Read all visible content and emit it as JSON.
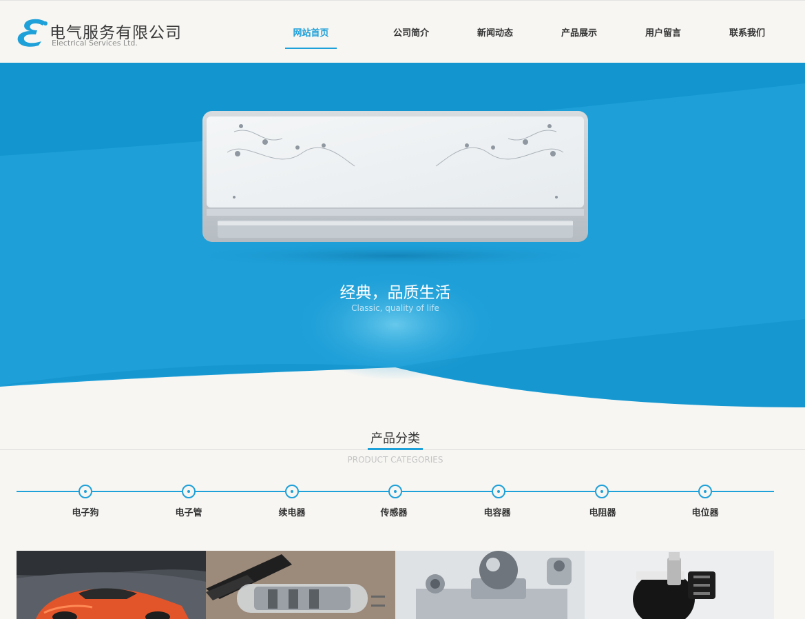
{
  "brand": {
    "name_cn": "电气服务有限公司",
    "name_en": "Electrical Services Ltd.",
    "logo_icon": "e-letter-logo",
    "accent_color": "#1ea0d8"
  },
  "nav": {
    "items": [
      {
        "label": "网站首页",
        "active": true
      },
      {
        "label": "公司简介",
        "active": false
      },
      {
        "label": "新闻动态",
        "active": false
      },
      {
        "label": "产品展示",
        "active": false
      },
      {
        "label": "用户留言",
        "active": false
      },
      {
        "label": "联系我们",
        "active": false
      }
    ]
  },
  "banner": {
    "title": "经典，品质生活",
    "subtitle": "Classic, quality of life",
    "image": "air-conditioner-image"
  },
  "categories": {
    "title": "产品分类",
    "subtitle": "PRODUCT CATEGORIES",
    "items": [
      {
        "label": "电子狗"
      },
      {
        "label": "电子管"
      },
      {
        "label": "续电器"
      },
      {
        "label": "传感器"
      },
      {
        "label": "电容器"
      },
      {
        "label": "电阻器"
      },
      {
        "label": "电位器"
      }
    ]
  },
  "products": [
    {
      "image": "red-sports-car-image"
    },
    {
      "image": "vacuum-tube-image"
    },
    {
      "image": "load-cell-sensor-image"
    },
    {
      "image": "potentiometer-image"
    }
  ]
}
